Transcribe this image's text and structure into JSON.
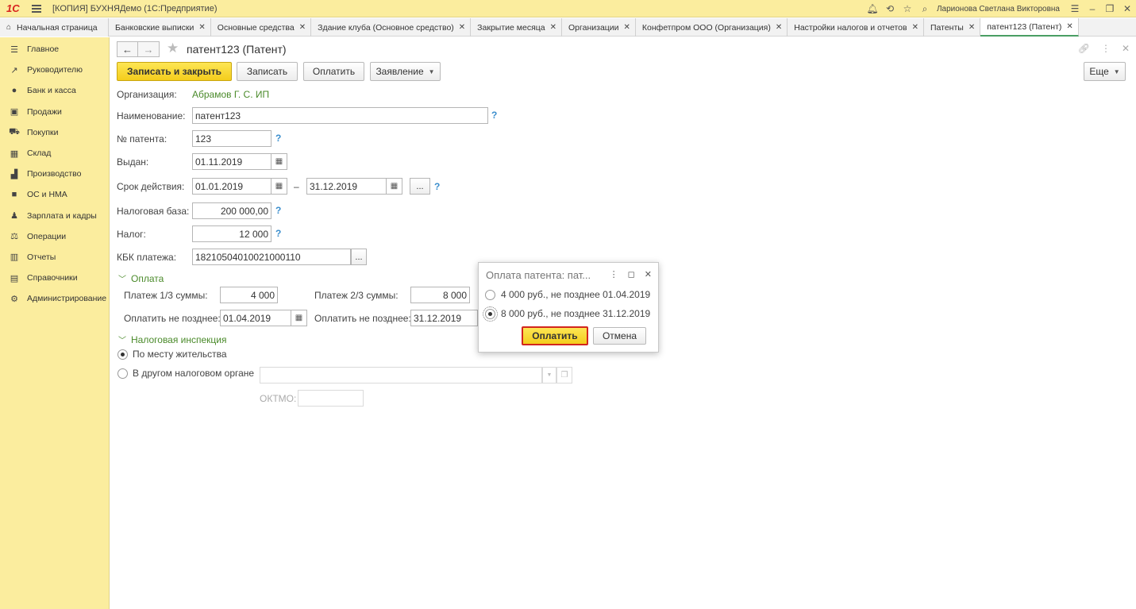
{
  "titlebar": {
    "logo": "1С",
    "app_title": "[КОПИЯ] БУХНЯДемо  (1С:Предприятие)",
    "user_name": "Ларионова Светлана Викторовна"
  },
  "tabs": {
    "home_label": "Начальная страница",
    "items": [
      {
        "label": "Банковские выписки"
      },
      {
        "label": "Основные средства"
      },
      {
        "label": "Здание клуба (Основное средство)"
      },
      {
        "label": "Закрытие месяца"
      },
      {
        "label": "Организации"
      },
      {
        "label": "Конфетпром ООО (Организация)"
      },
      {
        "label": "Настройки налогов и отчетов"
      },
      {
        "label": "Патенты"
      },
      {
        "label": "патент123 (Патент)"
      }
    ]
  },
  "sidebar": {
    "items": [
      {
        "label": "Главное",
        "icon": "list-icon"
      },
      {
        "label": "Руководителю",
        "icon": "trend-icon"
      },
      {
        "label": "Банк и касса",
        "icon": "coin-icon"
      },
      {
        "label": "Продажи",
        "icon": "bag-icon"
      },
      {
        "label": "Покупки",
        "icon": "cart-icon"
      },
      {
        "label": "Склад",
        "icon": "warehouse-icon"
      },
      {
        "label": "Производство",
        "icon": "factory-icon"
      },
      {
        "label": "ОС и НМА",
        "icon": "truck-icon"
      },
      {
        "label": "Зарплата и кадры",
        "icon": "person-icon"
      },
      {
        "label": "Операции",
        "icon": "operations-icon"
      },
      {
        "label": "Отчеты",
        "icon": "chart-icon"
      },
      {
        "label": "Справочники",
        "icon": "book-icon"
      },
      {
        "label": "Администрирование",
        "icon": "gear-icon"
      }
    ]
  },
  "doc": {
    "title": "патент123 (Патент)"
  },
  "toolbar": {
    "save_close": "Записать и закрыть",
    "save": "Записать",
    "pay": "Оплатить",
    "statement": "Заявление",
    "more": "Еще"
  },
  "form": {
    "org_label": "Организация:",
    "org_value": "Абрамов Г. С. ИП",
    "name_label": "Наименование:",
    "name_value": "патент123",
    "number_label": "№ патента:",
    "number_value": "123",
    "issued_label": "Выдан:",
    "issued_value": "01.11.2019",
    "period_label": "Срок действия:",
    "period_from": "01.01.2019",
    "period_dash": "–",
    "period_to": "31.12.2019",
    "base_label": "Налоговая база:",
    "base_value": "200 000,00",
    "tax_label": "Налог:",
    "tax_value": "12 000",
    "kbk_label": "КБК платежа:",
    "kbk_value": "18210504010021000110",
    "dots": "...",
    "help": "?"
  },
  "payment": {
    "section": "Оплата",
    "part1_label": "Платеж 1/3 суммы:",
    "part1_value": "4 000",
    "part2_label": "Платеж 2/3 суммы:",
    "part2_value": "8 000",
    "due_label": "Оплатить не позднее:",
    "due1_value": "01.04.2019",
    "due2_value": "31.12.2019"
  },
  "inspection": {
    "section": "Налоговая инспекция",
    "opt1": "По месту жительства",
    "opt2": "В другом налоговом органе",
    "oktmo_label": "ОКТМО:"
  },
  "popup": {
    "title": "Оплата патента: пат...",
    "option1": "4 000 руб., не позднее 01.04.2019",
    "option2": "8 000 руб., не позднее 31.12.2019",
    "pay": "Оплатить",
    "cancel": "Отмена"
  }
}
